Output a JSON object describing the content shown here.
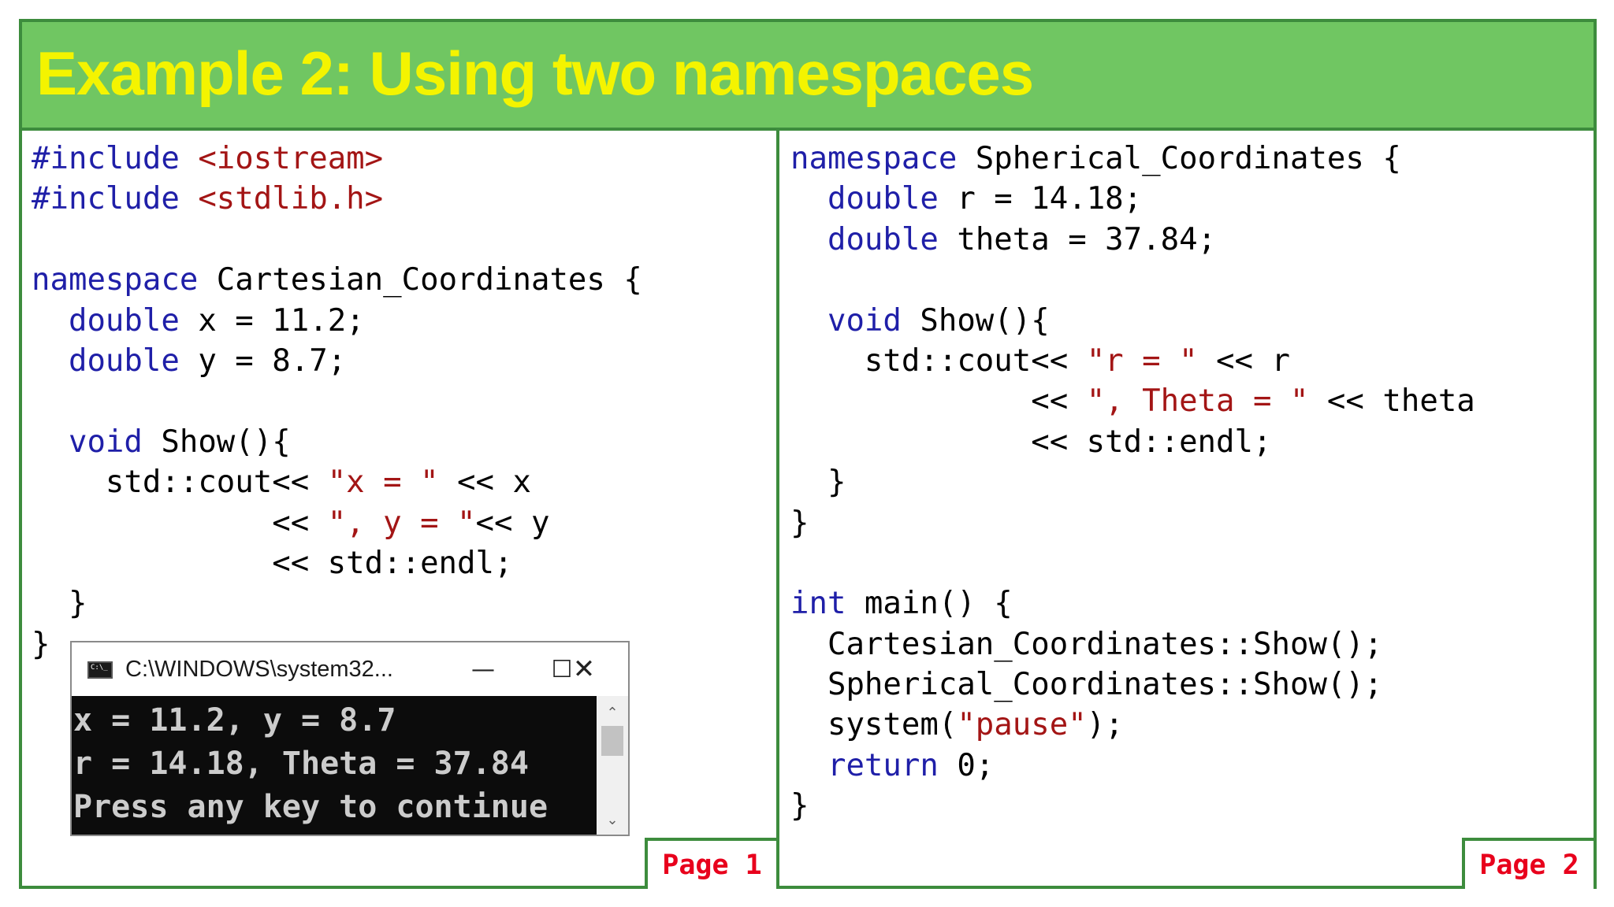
{
  "slide": {
    "title": "Example 2: Using two namespaces",
    "page_labels": [
      "Page 1",
      "Page 2"
    ]
  },
  "code_left": [
    [
      [
        "#include ",
        "kw"
      ],
      [
        "<iostream>",
        "str"
      ]
    ],
    [
      [
        "#include ",
        "kw"
      ],
      [
        "<stdlib.h>",
        "str"
      ]
    ],
    [],
    [
      [
        "namespace",
        "kw"
      ],
      [
        " Cartesian_Coordinates {",
        ""
      ]
    ],
    [
      [
        "  ",
        ""
      ],
      [
        "double",
        "kw"
      ],
      [
        " x = 11.2;",
        ""
      ]
    ],
    [
      [
        "  ",
        ""
      ],
      [
        "double",
        "kw"
      ],
      [
        " y = 8.7;",
        ""
      ]
    ],
    [],
    [
      [
        "  ",
        ""
      ],
      [
        "void",
        "kw"
      ],
      [
        " Show(){",
        ""
      ]
    ],
    [
      [
        "    std::cout<< ",
        ""
      ],
      [
        "\"x = \"",
        "str"
      ],
      [
        " << x",
        ""
      ]
    ],
    [
      [
        "             << ",
        ""
      ],
      [
        "\", y = \"",
        "str"
      ],
      [
        "<< y",
        ""
      ]
    ],
    [
      [
        "             << std::endl;",
        ""
      ]
    ],
    [
      [
        "  }",
        ""
      ]
    ],
    [
      [
        "}",
        ""
      ]
    ]
  ],
  "code_right": [
    [
      [
        "namespace",
        "kw"
      ],
      [
        " Spherical_Coordinates {",
        ""
      ]
    ],
    [
      [
        "  ",
        ""
      ],
      [
        "double",
        "kw"
      ],
      [
        " r = 14.18;",
        ""
      ]
    ],
    [
      [
        "  ",
        ""
      ],
      [
        "double",
        "kw"
      ],
      [
        " theta = 37.84;",
        ""
      ]
    ],
    [],
    [
      [
        "  ",
        ""
      ],
      [
        "void",
        "kw"
      ],
      [
        " Show(){",
        ""
      ]
    ],
    [
      [
        "    std::cout<< ",
        ""
      ],
      [
        "\"r = \"",
        "str"
      ],
      [
        " << r",
        ""
      ]
    ],
    [
      [
        "             << ",
        ""
      ],
      [
        "\", Theta = \"",
        "str"
      ],
      [
        " << theta",
        ""
      ]
    ],
    [
      [
        "             << std::endl;",
        ""
      ]
    ],
    [
      [
        "  }",
        ""
      ]
    ],
    [
      [
        "}",
        ""
      ]
    ],
    [],
    [
      [
        "int",
        "kw"
      ],
      [
        " main() {",
        ""
      ]
    ],
    [
      [
        "  Cartesian_Coordinates::Show();",
        ""
      ]
    ],
    [
      [
        "  Spherical_Coordinates::Show();",
        ""
      ]
    ],
    [
      [
        "  system(",
        ""
      ],
      [
        "\"pause\"",
        "str"
      ],
      [
        ");",
        ""
      ]
    ],
    [
      [
        "  ",
        ""
      ],
      [
        "return",
        "kw"
      ],
      [
        " 0;",
        ""
      ]
    ],
    [
      [
        "}",
        ""
      ]
    ]
  ],
  "console": {
    "title": "C:\\WINDOWS\\system32...",
    "icon": "console-app-icon",
    "minimize_glyph": "—",
    "maximize_glyph": "☐",
    "close_glyph": "✕",
    "output_lines": [
      "x = 11.2, y = 8.7",
      "r = 14.18, Theta = 37.84",
      "Press any key to continue"
    ],
    "scroll_up_glyph": "⌃",
    "scroll_down_glyph": "⌄"
  },
  "colors": {
    "title_bar": "#70c662",
    "title_text": "#f4f400",
    "border": "#3d8c3d",
    "keyword": "#1f1fa8",
    "string": "#a31515",
    "page_label": "#e8001c"
  }
}
